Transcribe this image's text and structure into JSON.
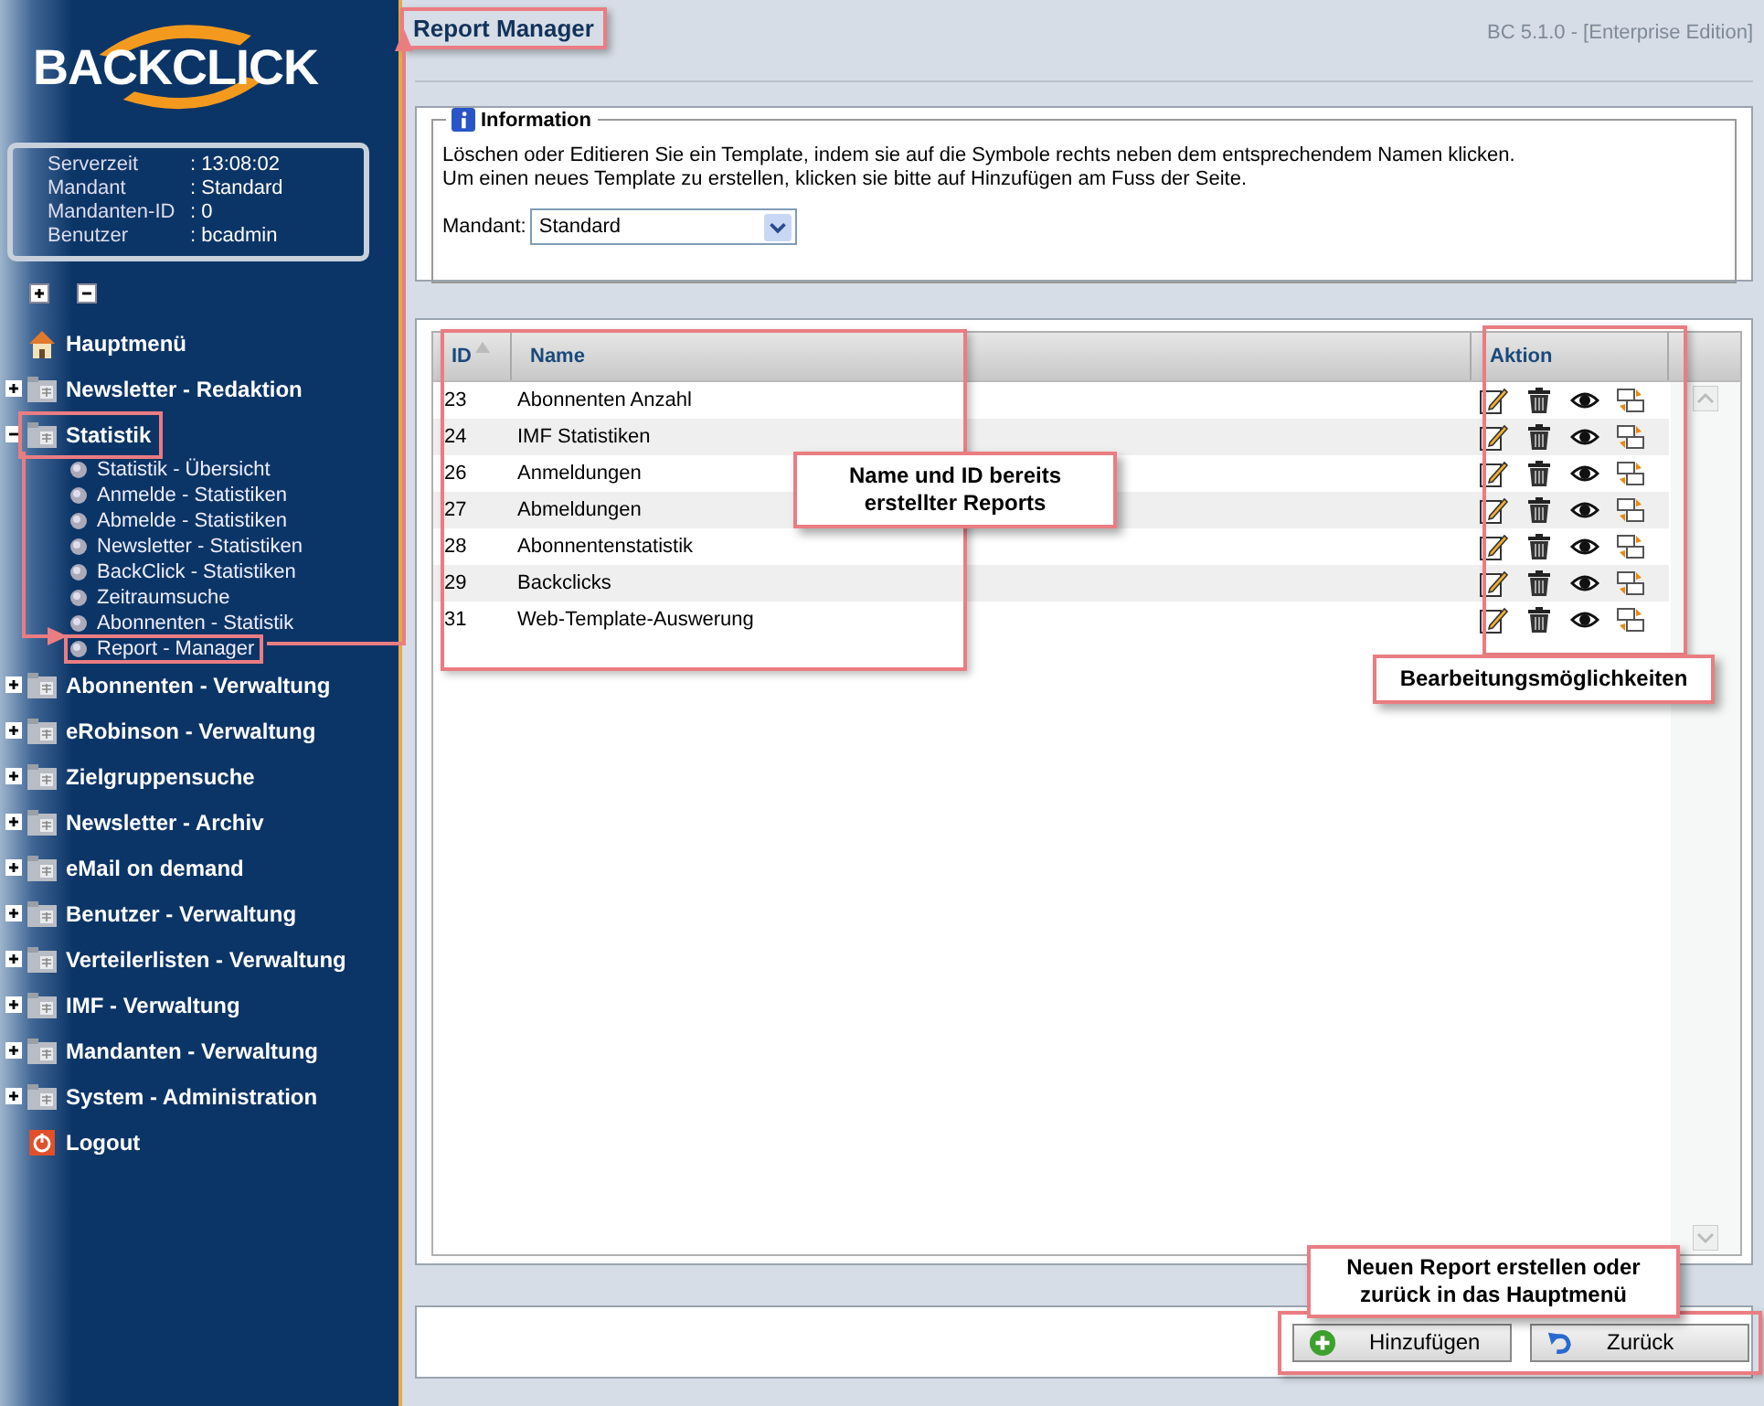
{
  "logo": "BACKCLICK",
  "server_info": [
    {
      "label": "Serverzeit",
      "value": ": 13:08:02"
    },
    {
      "label": "Mandant",
      "value": ": Standard"
    },
    {
      "label": "Mandanten-ID",
      "value": ": 0"
    },
    {
      "label": "Benutzer",
      "value": ": bcadmin"
    }
  ],
  "nav": [
    {
      "label": "Hauptmenü",
      "kind": "home",
      "highlighted": false
    },
    {
      "label": "Newsletter - Redaktion",
      "kind": "folder",
      "expanded": false,
      "highlighted": false
    },
    {
      "label": "Statistik",
      "kind": "folder",
      "expanded": true,
      "highlighted": true,
      "children": [
        {
          "label": "Statistik - Übersicht",
          "highlighted": false
        },
        {
          "label": "Anmelde - Statistiken",
          "highlighted": false
        },
        {
          "label": "Abmelde - Statistiken",
          "highlighted": false
        },
        {
          "label": "Newsletter - Statistiken",
          "highlighted": false
        },
        {
          "label": "BackClick - Statistiken",
          "highlighted": false
        },
        {
          "label": "Zeitraumsuche",
          "highlighted": false
        },
        {
          "label": "Abonnenten - Statistik",
          "highlighted": false
        },
        {
          "label": "Report - Manager",
          "highlighted": true
        }
      ]
    },
    {
      "label": "Abonnenten - Verwaltung",
      "kind": "folder",
      "expanded": false,
      "highlighted": false
    },
    {
      "label": "eRobinson - Verwaltung",
      "kind": "folder",
      "expanded": false,
      "highlighted": false
    },
    {
      "label": "Zielgruppensuche",
      "kind": "folder",
      "expanded": false,
      "highlighted": false
    },
    {
      "label": "Newsletter - Archiv",
      "kind": "folder",
      "expanded": false,
      "highlighted": false
    },
    {
      "label": "eMail on demand",
      "kind": "folder",
      "expanded": false,
      "highlighted": false
    },
    {
      "label": "Benutzer - Verwaltung",
      "kind": "folder",
      "expanded": false,
      "highlighted": false
    },
    {
      "label": "Verteilerlisten - Verwaltung",
      "kind": "folder",
      "expanded": false,
      "highlighted": false
    },
    {
      "label": "IMF - Verwaltung",
      "kind": "folder",
      "expanded": false,
      "highlighted": false
    },
    {
      "label": "Mandanten - Verwaltung",
      "kind": "folder",
      "expanded": false,
      "highlighted": false
    },
    {
      "label": "System - Administration",
      "kind": "folder",
      "expanded": false,
      "highlighted": false
    },
    {
      "label": "Logout",
      "kind": "logout",
      "highlighted": false
    }
  ],
  "header": {
    "title": "Report Manager",
    "highlighted": true,
    "version": "BC 5.1.0 - [Enterprise Edition]"
  },
  "info": {
    "legend": "Information",
    "lines": [
      "Löschen oder Editieren Sie ein Template, indem sie auf die Symbole rechts neben dem entsprechendem Namen klicken.",
      "Um einen neues Template zu erstellen, klicken sie bitte auf Hinzufügen am Fuss der Seite."
    ],
    "mandant_label": "Mandant:",
    "mandant_value": "Standard"
  },
  "table": {
    "columns": [
      {
        "label": "ID",
        "sorted": true
      },
      {
        "label": "Name",
        "sorted": false
      },
      {
        "label": "Aktion",
        "sorted": false
      }
    ],
    "rows": [
      {
        "id": "23",
        "name": "Abonnenten Anzahl"
      },
      {
        "id": "24",
        "name": "IMF Statistiken"
      },
      {
        "id": "26",
        "name": "Anmeldungen"
      },
      {
        "id": "27",
        "name": "Abmeldungen"
      },
      {
        "id": "28",
        "name": "Abonnentenstatistik"
      },
      {
        "id": "29",
        "name": "Backclicks"
      },
      {
        "id": "31",
        "name": "Web-Template-Auswerung"
      }
    ]
  },
  "buttons": [
    {
      "label": "Hinzufügen",
      "kind": "add"
    },
    {
      "label": "Zurück",
      "kind": "back"
    }
  ],
  "callouts": [
    "Name und ID bereits erstellter Reports",
    "Bearbeitungsmöglichkeiten",
    "Neuen Report erstellen oder zurück in das Hauptmenü"
  ]
}
